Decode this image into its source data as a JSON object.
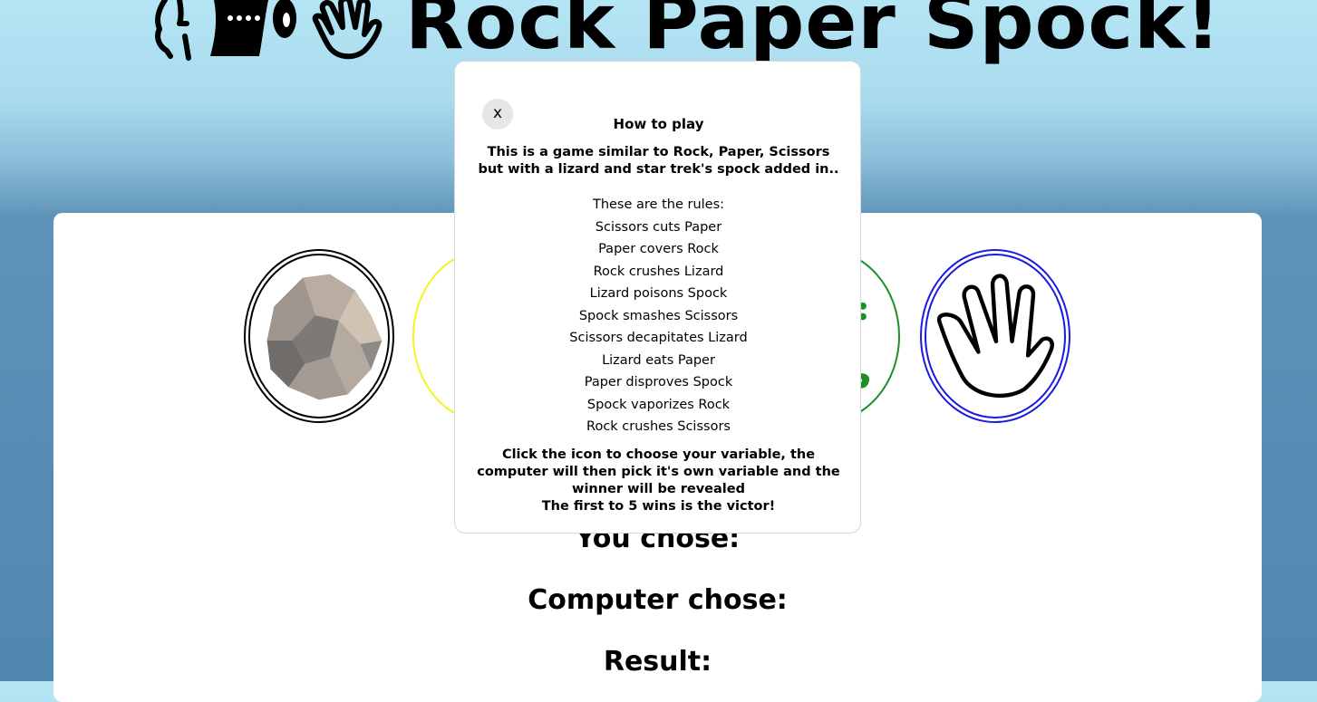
{
  "header": {
    "title": "Rock Paper Spock!",
    "icons": [
      "rock-hand-icon",
      "paper-icon",
      "spock-hand-icon"
    ]
  },
  "choices": [
    {
      "id": "rock",
      "icon": "rock-icon",
      "color": "#000000"
    },
    {
      "id": "paper",
      "icon": "paper-icon",
      "color": "#f5f222"
    },
    {
      "id": "lizard",
      "icon": "lizard-icon",
      "color": "#1d8f25"
    },
    {
      "id": "spock",
      "icon": "spock-hand-icon",
      "color": "#1a1ae0"
    }
  ],
  "results": {
    "you_chose": "You chose:",
    "computer_chose": "Computer chose:",
    "result": "Result:"
  },
  "modal": {
    "close_label": "x",
    "heading": "How to play",
    "intro": "This is a game similar to Rock, Paper, Scissors but with a lizard and star trek's spock added in..",
    "rules_heading": "These are the rules:",
    "rules": [
      "Scissors cuts Paper",
      "Paper covers Rock",
      "Rock crushes Lizard",
      "Lizard poisons Spock",
      "Spock smashes Scissors",
      "Scissors decapitates Lizard",
      "Lizard eats Paper",
      "Paper disproves Spock",
      "Spock vaporizes Rock",
      "Rock crushes Scissors"
    ],
    "instructions": "Click the icon to choose your variable, the computer will then pick it's own variable and the winner will be revealed",
    "victory": "The first to 5 wins is the victor!"
  }
}
